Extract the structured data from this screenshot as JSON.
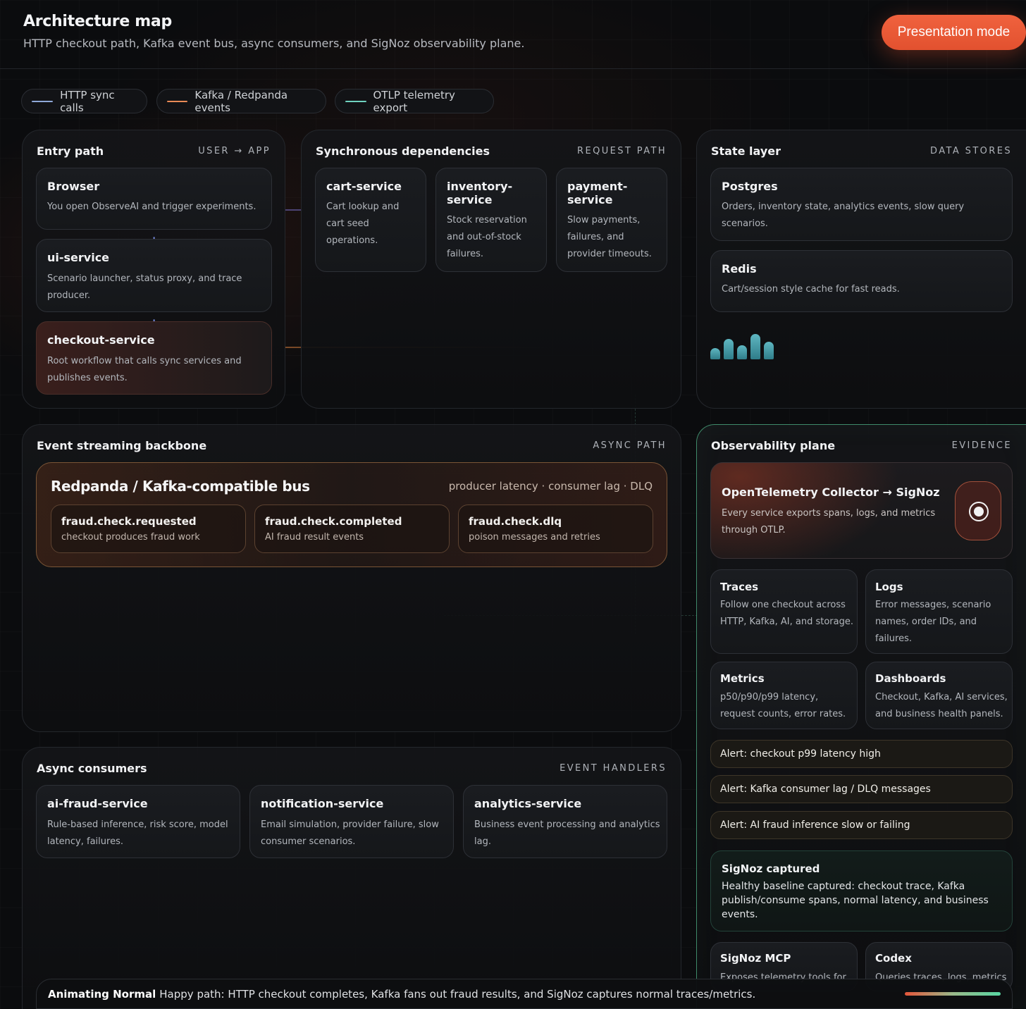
{
  "header": {
    "title": "Architecture map",
    "subtitle": "HTTP checkout path, Kafka event bus, async consumers, and SigNoz observability plane.",
    "presentation_button": "Presentation mode"
  },
  "legend": [
    {
      "label": "HTTP sync calls",
      "color": "#8fa8d8"
    },
    {
      "label": "Kafka / Redpanda events",
      "color": "#e98a56"
    },
    {
      "label": "OTLP telemetry export",
      "color": "#6fd3c0"
    }
  ],
  "entry": {
    "title": "Entry path",
    "tag": "USER → APP",
    "cards": [
      {
        "title": "Browser",
        "desc": "You open ObserveAI and trigger experiments."
      },
      {
        "title": "ui-service",
        "desc": "Scenario launcher, status proxy, and trace producer."
      },
      {
        "title": "checkout-service",
        "desc": "Root workflow that calls sync services and publishes events."
      }
    ],
    "arrow": "↓"
  },
  "sync": {
    "title": "Synchronous dependencies",
    "tag": "REQUEST PATH",
    "cards": [
      {
        "title": "cart-service",
        "desc": "Cart lookup and cart seed operations."
      },
      {
        "title": "inventory-service",
        "desc": "Stock reservation and out-of-stock failures."
      },
      {
        "title": "payment-service",
        "desc": "Slow payments, failures, and provider timeouts."
      }
    ]
  },
  "state": {
    "title": "State layer",
    "tag": "DATA STORES",
    "cards": [
      {
        "title": "Postgres",
        "desc": "Orders, inventory state, analytics events, slow query scenarios."
      },
      {
        "title": "Redis",
        "desc": "Cart/session style cache for fast reads."
      }
    ],
    "bar_levels": [
      0.45,
      0.8,
      0.55,
      1.0,
      0.7
    ]
  },
  "streaming": {
    "title": "Event streaming backbone",
    "tag": "ASYNC PATH",
    "bus_title": "Redpanda / Kafka-compatible bus",
    "bus_meta": "producer latency · consumer lag · DLQ",
    "topics": [
      {
        "title": "fraud.check.requested",
        "desc": "checkout produces fraud work"
      },
      {
        "title": "fraud.check.completed",
        "desc": "AI fraud result events"
      },
      {
        "title": "fraud.check.dlq",
        "desc": "poison messages and retries"
      }
    ]
  },
  "consumers": {
    "title": "Async consumers",
    "tag": "EVENT HANDLERS",
    "cards": [
      {
        "title": "ai-fraud-service",
        "desc": "Rule-based inference, risk score, model latency, failures."
      },
      {
        "title": "notification-service",
        "desc": "Email simulation, provider failure, slow consumer scenarios."
      },
      {
        "title": "analytics-service",
        "desc": "Business event processing and analytics lag."
      }
    ]
  },
  "observability": {
    "title": "Observability plane",
    "tag": "EVIDENCE",
    "collector_title": "OpenTelemetry Collector → SigNoz",
    "collector_desc": "Every service exports spans, logs, and metrics through OTLP.",
    "signals": [
      {
        "title": "Traces",
        "desc": "Follow one checkout across HTTP, Kafka, AI, and storage."
      },
      {
        "title": "Logs",
        "desc": "Error messages, scenario names, order IDs, and failures."
      },
      {
        "title": "Metrics",
        "desc": "p50/p90/p99 latency, request counts, error rates."
      },
      {
        "title": "Dashboards",
        "desc": "Checkout, Kafka, AI services, and business health panels."
      }
    ],
    "alerts": [
      "Alert: checkout p99 latency high",
      "Alert: Kafka consumer lag / DLQ messages",
      "Alert: AI fraud inference slow or failing"
    ],
    "captured_title": "SigNoz captured",
    "captured_desc": "Healthy baseline captured: checkout trace, Kafka publish/consume spans, normal latency, and business events.",
    "bottom_cards": [
      {
        "title": "SigNoz MCP",
        "desc": "Exposes telemetry tools for"
      },
      {
        "title": "Codex",
        "desc": "Queries traces, logs, metrics"
      }
    ]
  },
  "status": {
    "mode": "Animating Normal",
    "text": "Happy path: HTTP checkout completes, Kafka fans out fraud results, and SigNoz captures normal traces/metrics.",
    "progress": 1.0
  }
}
